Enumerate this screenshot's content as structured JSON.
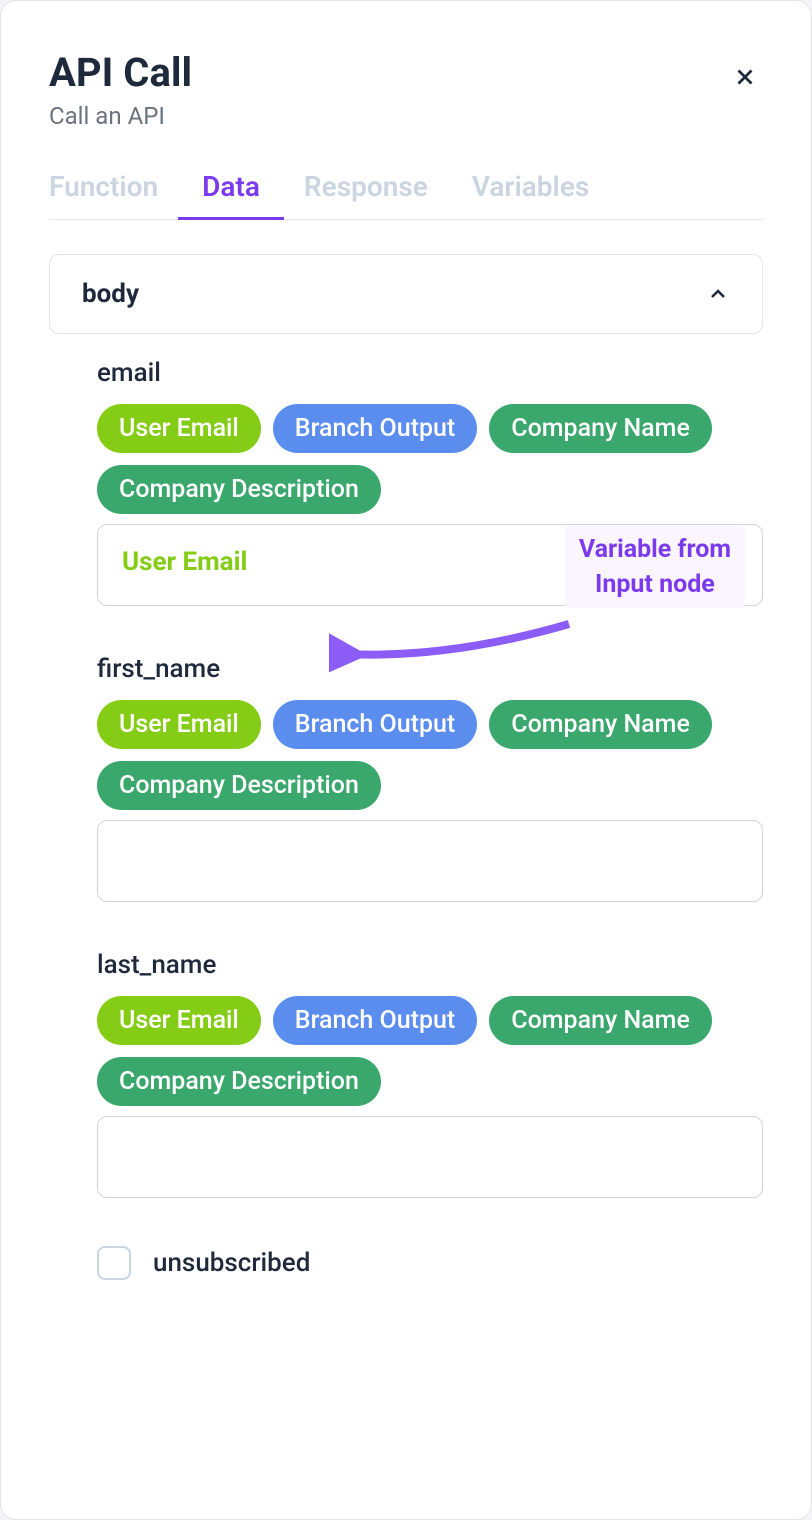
{
  "header": {
    "title": "API Call",
    "subtitle": "Call an API"
  },
  "tabs": {
    "t0": "Function",
    "t1": "Data",
    "t2": "Response",
    "t3": "Variables",
    "active": "Data"
  },
  "section": {
    "label": "body",
    "expanded": true
  },
  "variable_pills": {
    "user_email": "User Email",
    "branch_output": "Branch Output",
    "company_name": "Company Name",
    "company_description": "Company Description"
  },
  "fields": {
    "email": {
      "label": "email",
      "value": "User Email"
    },
    "first_name": {
      "label": "first_name",
      "value": ""
    },
    "last_name": {
      "label": "last_name",
      "value": ""
    },
    "unsubscribed": {
      "label": "unsubscribed",
      "checked": false
    }
  },
  "annotation": {
    "line1": "Variable from",
    "line2": "Input node"
  },
  "colors": {
    "accent": "#7c3aed",
    "pill_lime": "#84cc16",
    "pill_blue": "#5b8def",
    "pill_green": "#3aa76d"
  }
}
